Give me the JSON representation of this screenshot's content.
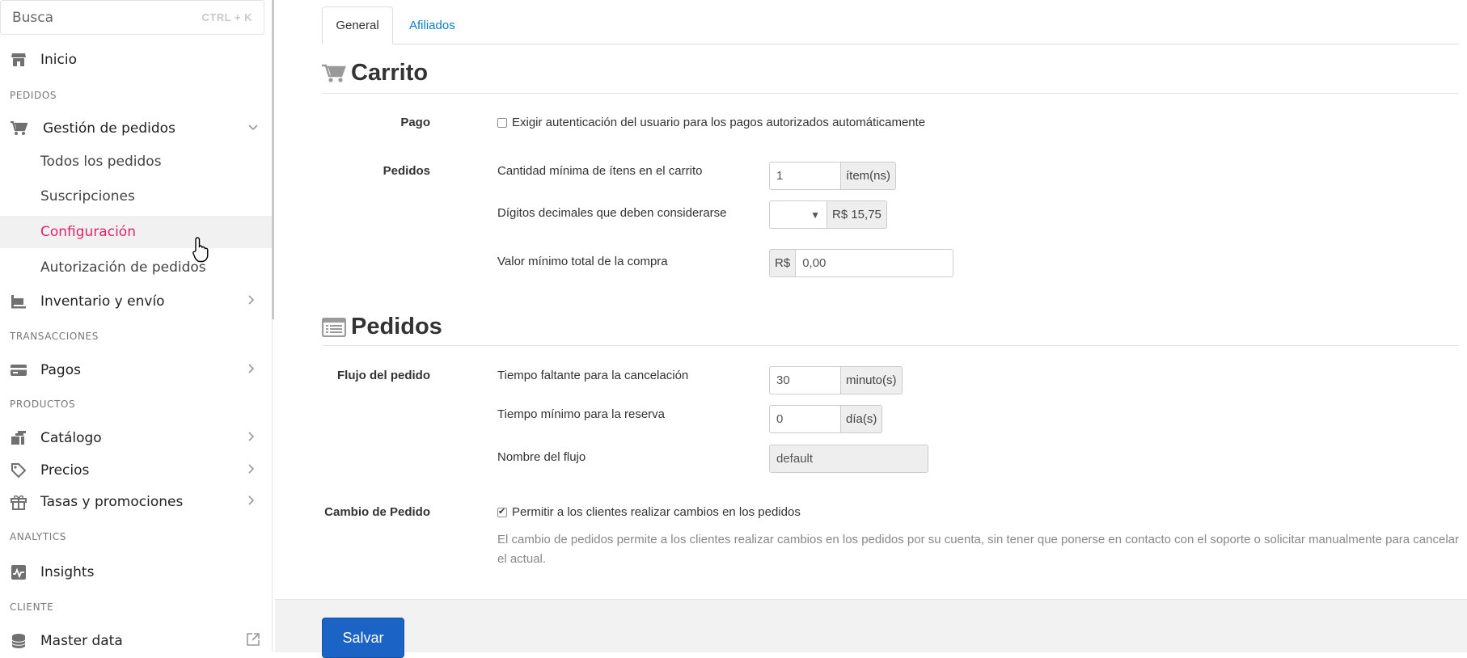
{
  "search": {
    "placeholder": "Busca",
    "shortcut": "CTRL + K"
  },
  "sidebar": {
    "home": "Inicio",
    "sections": {
      "pedidos": "PEDIDOS",
      "transacciones": "TRANSACCIONES",
      "productos": "PRODUCTOS",
      "analytics": "ANALYTICS",
      "cliente": "CLIENTE"
    },
    "order_mgmt": "Gestión de pedidos",
    "sub_items": [
      "Todos los pedidos",
      "Suscripciones",
      "Configuración",
      "Autorización de pedidos"
    ],
    "inventory": "Inventario y envío",
    "payments": "Pagos",
    "catalog": "Catálogo",
    "prices": "Precios",
    "promotions": "Tasas y promociones",
    "insights": "Insights",
    "master_data": "Master data"
  },
  "tabs": [
    "General",
    "Afiliados"
  ],
  "cart": {
    "title": "Carrito",
    "payment_label": "Pago",
    "payment_checkbox": "Exigir autenticación del usuario para los pagos autorizados automáticamente",
    "orders_label": "Pedidos",
    "min_items_label": "Cantidad mínima de ítens en el carrito",
    "min_items_value": "1",
    "min_items_unit": "ítem(ns)",
    "decimal_label": "Dígitos decimales que deben considerarse",
    "decimal_example": "R$ 15,75",
    "min_total_label": "Valor mínimo total de la compra",
    "currency": "R$",
    "min_total_value": "0,00"
  },
  "orders": {
    "title": "Pedidos",
    "flow_label": "Flujo del pedido",
    "cancel_time_label": "Tiempo faltante para la cancelación",
    "cancel_time_value": "30",
    "cancel_time_unit": "minuto(s)",
    "reserve_label": "Tiempo mínimo para la reserva",
    "reserve_value": "0",
    "reserve_unit": "día(s)",
    "flow_name_label": "Nombre del flujo",
    "flow_name_value": "default",
    "change_label": "Cambio de Pedido",
    "change_checkbox": "Permitir a los clientes realizar cambios en los pedidos",
    "change_checked": true,
    "change_help": "El cambio de pedidos permite a los clientes realizar cambios en los pedidos por su cuenta, sin tener que ponerse en contacto con el soporte o solicitar manualmente para cancelar el actual."
  },
  "footer": {
    "save_label": "Salvar"
  },
  "colors": {
    "active_nav": "#e0226b",
    "link": "#0a7fc6",
    "primary_button": "#1b63c4"
  }
}
